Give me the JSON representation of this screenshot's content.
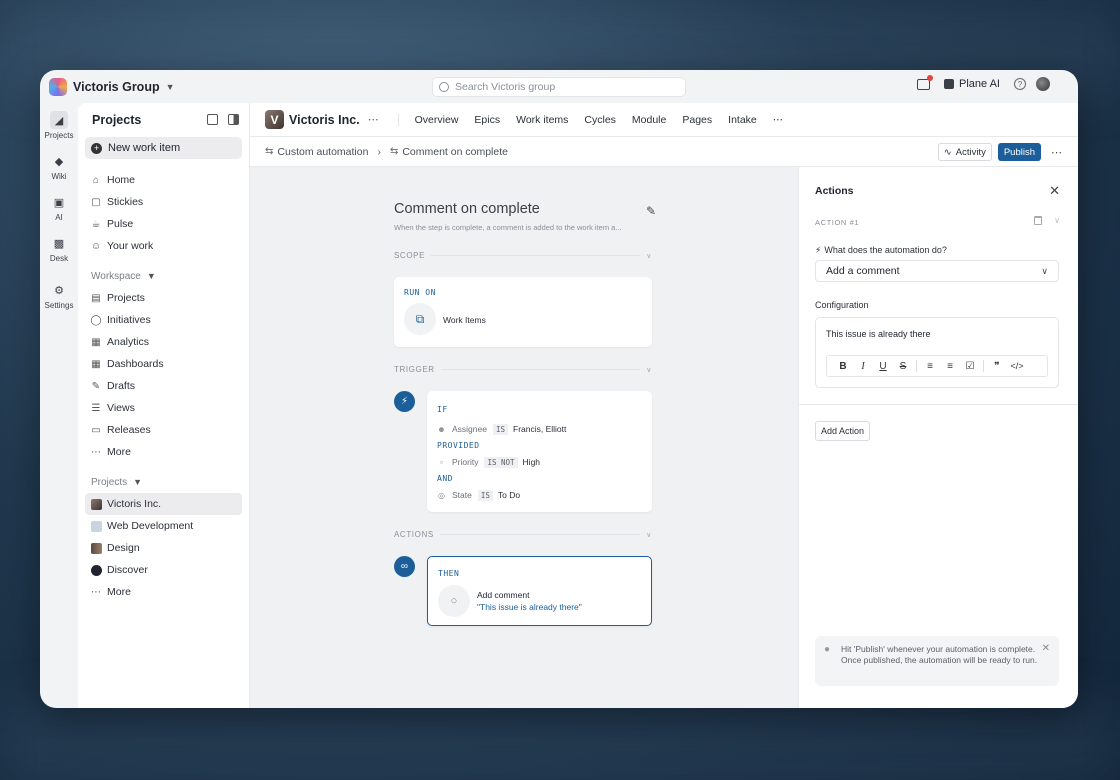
{
  "workspace": {
    "name": "Victoris Group"
  },
  "search": {
    "placeholder": "Search Victoris group"
  },
  "topbar": {
    "plane_ai": "Plane AI"
  },
  "rail": [
    {
      "label": "Projects",
      "icon": "projects-icon"
    },
    {
      "label": "Wiki",
      "icon": "wiki-icon"
    },
    {
      "label": "AI",
      "icon": "ai-icon"
    },
    {
      "label": "Desk",
      "icon": "desk-icon"
    },
    {
      "label": "Settings",
      "icon": "settings-icon"
    }
  ],
  "sidebar": {
    "title": "Projects",
    "new_item": "New work item",
    "main": [
      "Home",
      "Stickies",
      "Pulse",
      "Your work"
    ],
    "workspace_label": "Workspace",
    "workspace": [
      "Projects",
      "Initiatives",
      "Analytics",
      "Dashboards",
      "Drafts",
      "Views",
      "Releases",
      "More"
    ],
    "projects_label": "Projects",
    "projects": [
      "Victoris Inc.",
      "Web Development",
      "Design",
      "Discover",
      "More"
    ]
  },
  "project": {
    "logo_letter": "V",
    "name": "Victoris Inc.",
    "tabs": [
      "Overview",
      "Epics",
      "Work items",
      "Cycles",
      "Module",
      "Pages",
      "Intake"
    ]
  },
  "breadcrumb": {
    "parent": "Custom automation",
    "current": "Comment on complete"
  },
  "header_actions": {
    "activity": "Activity",
    "publish": "Publish"
  },
  "flow": {
    "title": "Comment on complete",
    "description": "When the step is complete, a comment is added to the work item a...",
    "scope_label": "SCOPE",
    "run_on": "RUN ON",
    "scope_value": "Work Items",
    "trigger_label": "TRIGGER",
    "if_kw": "IF",
    "provided_kw": "PROVIDED",
    "and_kw": "AND",
    "conditions": [
      {
        "field": "Assignee",
        "op": "IS",
        "value": "Francis, Elliott"
      },
      {
        "field": "Priority",
        "op": "IS NOT",
        "value": "High"
      },
      {
        "field": "State",
        "op": "IS",
        "value": "To Do"
      }
    ],
    "actions_label": "ACTIONS",
    "then_kw": "THEN",
    "action_name": "Add comment",
    "action_value": "\"This issue is already there\""
  },
  "actions_panel": {
    "title": "Actions",
    "action_num": "ACTION #1",
    "question": "What does the automation do?",
    "selected": "Add a comment",
    "config_label": "Configuration",
    "editor_text": "This issue is already there",
    "add_action": "Add Action",
    "hint": "Hit 'Publish' whenever your automation is complete. Once published, the automation will be ready to run."
  }
}
